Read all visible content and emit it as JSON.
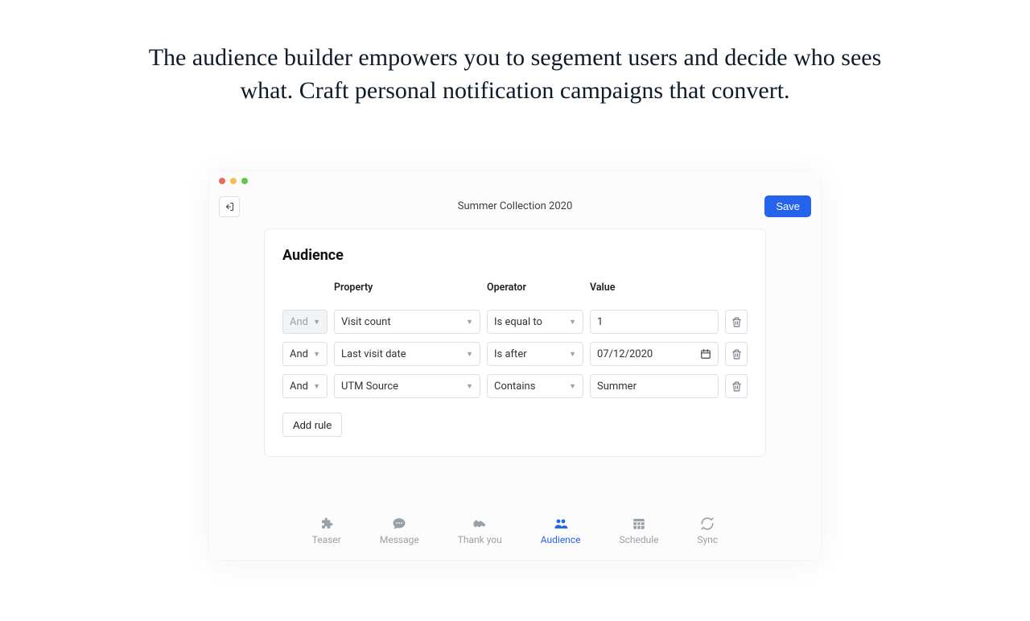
{
  "hero": "The audience builder empowers you to segement users and decide who sees what.  Craft personal notification campaigns that convert.",
  "toolbar": {
    "title": "Summer Collection 2020",
    "save_label": "Save"
  },
  "panel": {
    "title": "Audience",
    "headers": {
      "property": "Property",
      "operator": "Operator",
      "value": "Value"
    },
    "rules": [
      {
        "logic": "And",
        "logic_disabled": true,
        "property": "Visit count",
        "operator": "Is equal to",
        "value": "1",
        "value_type": "text"
      },
      {
        "logic": "And",
        "logic_disabled": false,
        "property": "Last visit date",
        "operator": "Is after",
        "value": "07/12/2020",
        "value_type": "date"
      },
      {
        "logic": "And",
        "logic_disabled": false,
        "property": "UTM Source",
        "operator": "Contains",
        "value": "Summer",
        "value_type": "text"
      }
    ],
    "add_rule_label": "Add rule"
  },
  "tabs": [
    {
      "key": "teaser",
      "label": "Teaser",
      "icon": "puzzle",
      "active": false
    },
    {
      "key": "message",
      "label": "Message",
      "icon": "chat",
      "active": false
    },
    {
      "key": "thankyou",
      "label": "Thank you",
      "icon": "handshake",
      "active": false
    },
    {
      "key": "audience",
      "label": "Audience",
      "icon": "people",
      "active": true
    },
    {
      "key": "schedule",
      "label": "Schedule",
      "icon": "calendar",
      "active": false
    },
    {
      "key": "sync",
      "label": "Sync",
      "icon": "refresh",
      "active": false
    }
  ]
}
